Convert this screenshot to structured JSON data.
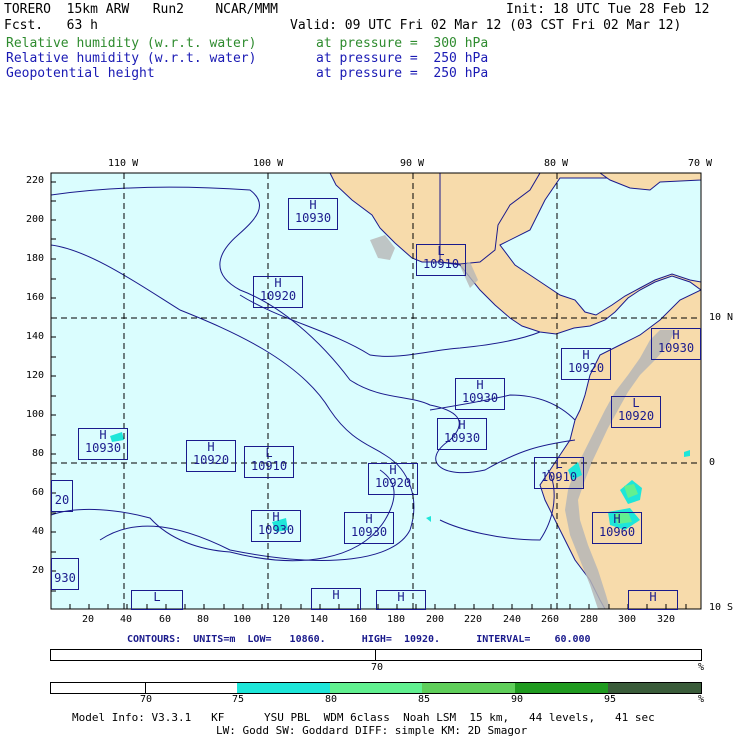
{
  "header": {
    "model": "TORERO  15km ARW   Run2    NCAR/MMM",
    "init": "Init: 18 UTC Tue 28 Feb 12",
    "fcst": "Fcst.   63 h",
    "valid": "Valid: 09 UTC Fri 02 Mar 12 (03 CST Fri 02 Mar 12)",
    "fields": [
      {
        "name": "Relative humidity (w.r.t. water)",
        "level": "at pressure =  300 hPa",
        "color": "#2e8b2e"
      },
      {
        "name": "Relative humidity (w.r.t. water)",
        "level": "at pressure =  250 hPa",
        "color": "#1a1ab4"
      },
      {
        "name": "Geopotential height",
        "level": "at pressure =  250 hPa",
        "color": "#1a1ab4"
      }
    ]
  },
  "map": {
    "top_lon_labels": [
      "110 W",
      "100 W",
      "90 W",
      "80 W",
      "70 W"
    ],
    "right_lat_labels": [
      "10 N",
      "0",
      "10 S"
    ],
    "left_ticks": [
      "220",
      "200",
      "180",
      "160",
      "140",
      "120",
      "100",
      "80",
      "60",
      "40",
      "20"
    ],
    "bottom_ticks": [
      "20",
      "40",
      "60",
      "80",
      "100",
      "120",
      "140",
      "160",
      "180",
      "200",
      "220",
      "240",
      "260",
      "280",
      "300",
      "320"
    ],
    "colors": {
      "ocean": "#dafdfe",
      "land": "#f7dbab",
      "terrain": "#b6b6b6",
      "contour": "#1a1a8c",
      "grid": "#000000"
    },
    "centers": [
      {
        "type": "H",
        "value": "10930"
      },
      {
        "type": "L",
        "value": "10910"
      },
      {
        "type": "H",
        "value": "10920"
      },
      {
        "type": "H",
        "value": "10920"
      },
      {
        "type": "H",
        "value": "10930"
      },
      {
        "type": "H",
        "value": "10930"
      },
      {
        "type": "L",
        "value": "10920"
      },
      {
        "type": "H",
        "value": "10930"
      },
      {
        "type": "H",
        "value": "10930"
      },
      {
        "type": "H",
        "value": "10930"
      },
      {
        "type": "H",
        "value": "10920"
      },
      {
        "type": "L",
        "value": "10910"
      },
      {
        "type": "H",
        "value": "10920"
      },
      {
        "type": "L",
        "value": "10910"
      },
      {
        "type": "H",
        "value": "10930"
      },
      {
        "type": "H",
        "value": "10930"
      },
      {
        "type": "H",
        "value": "10960"
      },
      {
        "type": "",
        "value": "20"
      },
      {
        "type": "",
        "value": "930"
      },
      {
        "type": "L",
        "value": ""
      },
      {
        "type": "H",
        "value": "10930"
      },
      {
        "type": "H",
        "value": ""
      },
      {
        "type": "H",
        "value": ""
      }
    ]
  },
  "contours_info": {
    "label": "CONTOURS:  UNITS=m  LOW=   10860.      HIGH=  10920.      INTERVAL=    60.000"
  },
  "colorbar_300": {
    "value_label": "70",
    "unit": "%",
    "colors": [
      "#ffffff",
      "#ffffff"
    ]
  },
  "colorbar_250": {
    "labels": [
      "70",
      "75",
      "80",
      "85",
      "90",
      "95"
    ],
    "unit": "%",
    "colors": [
      "#ffffff",
      "#ffffff",
      "#1ee6d9",
      "#61f090",
      "#5fce5a",
      "#1f9a1f",
      "#3a5c3a"
    ]
  },
  "footer": {
    "line1": "Model Info: V3.3.1   KF      YSU PBL  WDM 6class  Noah LSM  15 km,   44 levels,   41 sec",
    "line2": "LW: Godd SW: Goddard DIFF: simple KM: 2D Smagor"
  }
}
